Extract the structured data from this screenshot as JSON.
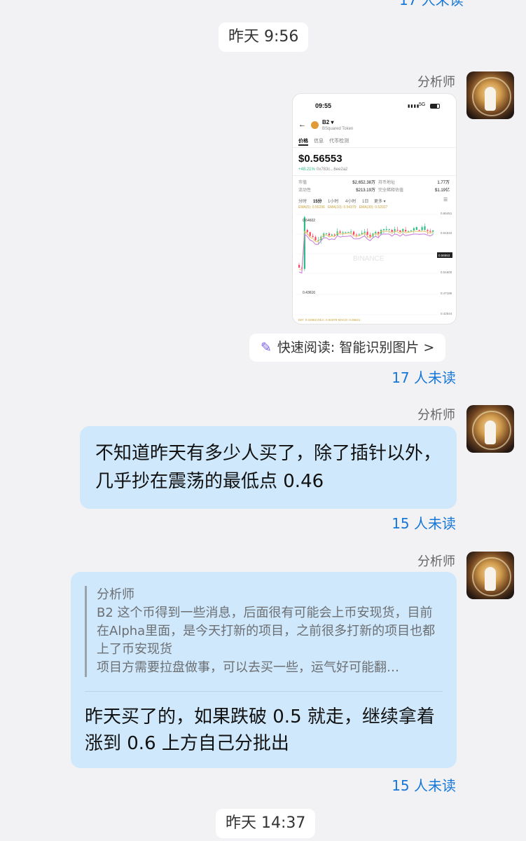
{
  "top_unread_cut": "17 人未读",
  "timestamps": [
    "昨天 9:56",
    "昨天 14:37"
  ],
  "sender_name": "分析师",
  "messages": [
    {
      "type": "image",
      "unread": "17 人未读",
      "ocr_label": "快速阅读: 智能识别图片 >",
      "screenshot": {
        "status_time": "09:55",
        "status_network": "5G",
        "token_symbol": "B2",
        "token_name": "BSquared Token",
        "tabs": [
          "价格",
          "信息",
          "代币检测"
        ],
        "price": "$0.56553",
        "change": "+48.21%",
        "address": "0x783c...6ee2a2",
        "stats": [
          {
            "label": "市值",
            "value": "$2,652.38万"
          },
          {
            "label": "持币地址",
            "value": "1.77万"
          },
          {
            "label": "流动性",
            "value": "$213.19万"
          },
          {
            "label": "完全稀释估值",
            "value": "$1.19亿"
          }
        ],
        "timeframes": [
          "分时",
          "15分",
          "1小时",
          "4小时",
          "1日",
          "更多"
        ],
        "ema_line": "EMA(5): 0.55236   EMA(10): 0.54379   EMA(30): 0.52027",
        "price_axis": [
          "0.65451",
          "0.61534",
          "0.56553",
          "0.51600",
          "0.47186",
          "0.42544"
        ],
        "high_label": "0.64602",
        "low_label": "0.43616",
        "watermark": "BINANCE",
        "macd_line": "DIF: 0.02862   DEA: 0.00379   MACD: 0.05621"
      }
    },
    {
      "type": "text",
      "text": "不知道昨天有多少人买了，除了插针以外，几乎抄在震荡的最低点 0.46",
      "unread": "15 人未读"
    },
    {
      "type": "reply",
      "quote_sender": "分析师",
      "quote_text": "B2 这个币得到一些消息，后面很有可能会上币安现货，目前在Alpha里面，是今天打新的项目，之前很多打新的项目也都上了币安现货\n项目方需要拉盘做事，可以去买一些，运气好可能翻…",
      "text": "昨天买了的，如果跌破 0.5 就走，继续拿着涨到 0.6 上方自己分批出",
      "unread": "15 人未读"
    }
  ],
  "colors": {
    "bubble": "#cfe8fb",
    "unread": "#1677d8",
    "bg": "#f2f2f4",
    "candle_up": "#2ebd85",
    "candle_down": "#f6465d"
  }
}
